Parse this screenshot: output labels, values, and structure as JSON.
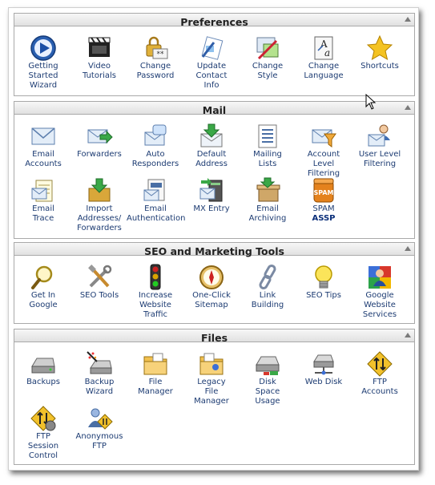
{
  "sections": {
    "preferences": {
      "title": "Preferences",
      "items": [
        {
          "label": "Getting\nStarted\nWizard",
          "icon": "play-icon"
        },
        {
          "label": "Video\nTutorials",
          "icon": "film-icon"
        },
        {
          "label": "Change\nPassword",
          "icon": "lock-icon"
        },
        {
          "label": "Update\nContact\nInfo",
          "icon": "contact-icon"
        },
        {
          "label": "Change\nStyle",
          "icon": "style-icon"
        },
        {
          "label": "Change\nLanguage",
          "icon": "language-icon"
        },
        {
          "label": "Shortcuts",
          "icon": "star-icon"
        }
      ]
    },
    "mail": {
      "title": "Mail",
      "items": [
        {
          "label": "Email\nAccounts",
          "icon": "envelope-icon"
        },
        {
          "label": "Forwarders",
          "icon": "forward-icon"
        },
        {
          "label": "Auto\nResponders",
          "icon": "autoresponder-icon"
        },
        {
          "label": "Default\nAddress",
          "icon": "default-address-icon"
        },
        {
          "label": "Mailing\nLists",
          "icon": "list-icon"
        },
        {
          "label": "Account\nLevel\nFiltering",
          "icon": "filter-icon"
        },
        {
          "label": "User Level\nFiltering",
          "icon": "user-filter-icon"
        },
        {
          "label": "Email\nTrace",
          "icon": "trace-icon"
        },
        {
          "label": "Import\nAddresses/\nForwarders",
          "icon": "import-icon"
        },
        {
          "label": "Email\nAuthentication",
          "icon": "authentication-icon"
        },
        {
          "label": "MX Entry",
          "icon": "mx-icon"
        },
        {
          "label": "Email\nArchiving",
          "icon": "archive-icon"
        },
        {
          "label": "SPAM",
          "sub": "ASSP",
          "icon": "spam-icon"
        }
      ]
    },
    "seo": {
      "title": "SEO and Marketing Tools",
      "items": [
        {
          "label": "Get In\nGoogle",
          "icon": "magnifier-icon"
        },
        {
          "label": "SEO Tools",
          "icon": "tools-icon"
        },
        {
          "label": "Increase\nWebsite\nTraffic",
          "icon": "traffic-light-icon"
        },
        {
          "label": "One-Click\nSitemap",
          "icon": "compass-icon"
        },
        {
          "label": "Link\nBuilding",
          "icon": "chain-icon"
        },
        {
          "label": "SEO Tips",
          "icon": "lightbulb-icon"
        },
        {
          "label": "Google\nWebsite\nServices",
          "icon": "google-icon"
        }
      ]
    },
    "files": {
      "title": "Files",
      "items": [
        {
          "label": "Backups",
          "icon": "backup-icon"
        },
        {
          "label": "Backup\nWizard",
          "icon": "backup-wizard-icon"
        },
        {
          "label": "File\nManager",
          "icon": "folder-icon"
        },
        {
          "label": "Legacy\nFile\nManager",
          "icon": "legacy-folder-icon"
        },
        {
          "label": "Disk\nSpace\nUsage",
          "icon": "disk-icon"
        },
        {
          "label": "Web Disk",
          "icon": "web-disk-icon"
        },
        {
          "label": "FTP\nAccounts",
          "icon": "ftp-icon"
        },
        {
          "label": "FTP\nSession\nControl",
          "icon": "ftp-session-icon"
        },
        {
          "label": "Anonymous\nFTP",
          "icon": "anonymous-ftp-icon"
        }
      ]
    }
  }
}
